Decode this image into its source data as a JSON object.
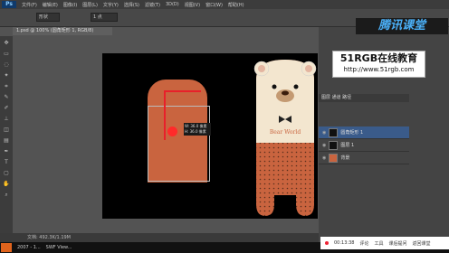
{
  "menu": [
    "文件(F)",
    "编辑(E)",
    "图像(I)",
    "图层(L)",
    "文字(Y)",
    "选择(S)",
    "滤镜(T)",
    "3D(D)",
    "视图(V)",
    "窗口(W)",
    "帮助(H)"
  ],
  "app_logo": "Ps",
  "options": {
    "mode": "形状",
    "size": "1 点"
  },
  "doc_tab": "1.psd @ 100% (圆角矩形 1, RGB/8)",
  "tooltip": {
    "w": "W: 36.0 像素",
    "h": "H: 36.0 像素"
  },
  "bear": {
    "title": "Bear World",
    "colors": {
      "cream": "#f3e6cf",
      "brown": "#c9643f",
      "dark": "#5a2f1c"
    }
  },
  "watermark": {
    "line1": "51RGB在线教育",
    "line2": "http://www.51rgb.com"
  },
  "brand": "腾讯课堂",
  "panels": {
    "tabs": "图层  通道  路径",
    "zoom": "33.33%"
  },
  "layers": [
    {
      "name": "圆角矩形 1",
      "active": true
    },
    {
      "name": "图层 1",
      "active": false
    },
    {
      "name": "背景",
      "active": false
    }
  ],
  "status": "文档: 492.3K/1.19M",
  "taskbar": {
    "items": [
      "2007 - 1...",
      "SWF View..."
    ]
  },
  "player": {
    "time": "00:13:38",
    "items": [
      "评论",
      "工具",
      "课后提问",
      "返回课堂"
    ]
  }
}
